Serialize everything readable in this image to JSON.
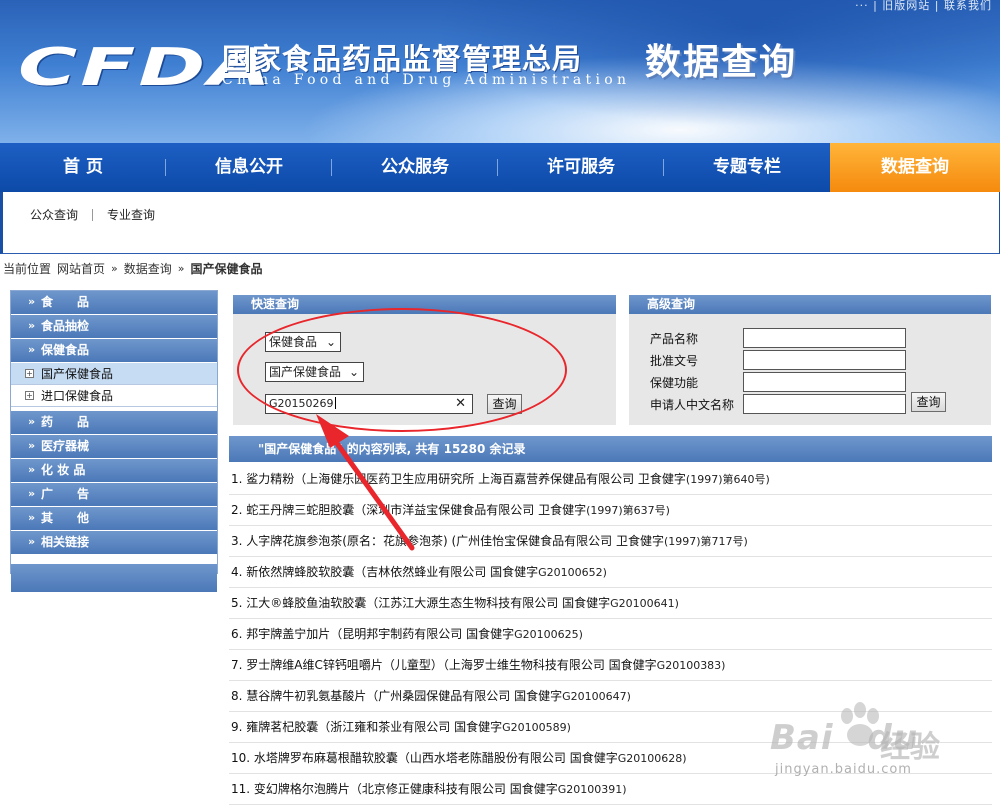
{
  "banner": {
    "top_links": "··· | 旧版网站 | 联系我们",
    "logo": "CFDA",
    "agency_cn": "国家食品药品监督管理总局",
    "agency_en": "China Food and Drug Administration",
    "subtitle": "数据查询"
  },
  "nav": {
    "items": [
      {
        "label": "首  页"
      },
      {
        "label": "信息公开"
      },
      {
        "label": "公众服务"
      },
      {
        "label": "许可服务"
      },
      {
        "label": "专题专栏"
      },
      {
        "label": "数据查询",
        "active": true
      }
    ],
    "active_color": "#f5900f"
  },
  "subnav": {
    "items": [
      "公众查询",
      "专业查询"
    ]
  },
  "breadcrumb": {
    "prefix": "当前位置",
    "home": "网站首页",
    "section": "数据查询",
    "current": "国产保健食品",
    "sep": "»"
  },
  "sidebar": {
    "items": [
      {
        "label": "食　　品"
      },
      {
        "label": "食品抽检"
      },
      {
        "label": "保健食品"
      }
    ],
    "sub_items": [
      {
        "label": "国产保健食品",
        "selected": true
      },
      {
        "label": "进口保健食品",
        "selected": false
      }
    ],
    "items_after": [
      {
        "label": "药　　品"
      },
      {
        "label": "医疗器械"
      },
      {
        "label": "化 妆 品"
      },
      {
        "label": "广　　告"
      },
      {
        "label": "其　　他"
      },
      {
        "label": "相关链接"
      }
    ],
    "chevron": "»",
    "box": "+"
  },
  "quick_search": {
    "title": "快速查询",
    "category_select": "保健食品",
    "type_select": "国产保健食品",
    "search_value": "G20150269",
    "clear_glyph": "✕",
    "submit": "查询",
    "chevron": "⌄"
  },
  "advanced_search": {
    "title": "高级查询",
    "fields": [
      "产品名称",
      "批准文号",
      "保健功能",
      "申请人中文名称"
    ],
    "submit": "查询"
  },
  "results": {
    "header": "\"国产保健食品\" 的内容列表, 共有 15280 余记录",
    "items": [
      {
        "text": "1. 鲨力精粉（上海健乐园医药卫生应用研究所 上海百嘉营养保健品有限公司 卫食健字",
        "approval": "(1997)第640号)"
      },
      {
        "text": "2. 蛇王丹牌三蛇胆胶囊（深圳市洋益宝保健食品有限公司 卫食健字",
        "approval": "(1997)第637号)"
      },
      {
        "text": "3. 人字牌花旗参泡茶(原名：花旗参泡茶) (广州佳怡宝保健食品有限公司 卫食健字",
        "approval": "(1997)第717号)"
      },
      {
        "text": "4. 新依然牌蜂胶软胶囊（吉林依然蜂业有限公司 国食健字",
        "approval": "G20100652)"
      },
      {
        "text": "5. 江大®蜂胶鱼油软胶囊（江苏江大源生态生物科技有限公司 国食健字",
        "approval": "G20100641)"
      },
      {
        "text": "6. 邦宇牌盖宁加片（昆明邦宇制药有限公司 国食健字",
        "approval": "G20100625)"
      },
      {
        "text": "7. 罗士牌维A维C锌钙咀嚼片（儿童型）（上海罗士维生物科技有限公司 国食健字",
        "approval": "G20100383)"
      },
      {
        "text": "8. 慧谷牌牛初乳氨基酸片（广州桑园保健品有限公司 国食健字",
        "approval": "G20100647)"
      },
      {
        "text": "9. 雍牌茗杞胶囊（浙江雍和茶业有限公司 国食健字",
        "approval": "G20100589)"
      },
      {
        "text": "10. 水塔牌罗布麻葛根醋软胶囊（山西水塔老陈醋股份有限公司 国食健字",
        "approval": "G20100628)"
      },
      {
        "text": "11. 变幻牌格尔泡腾片（北京修正健康科技有限公司 国食健字",
        "approval": "G20100391)"
      }
    ]
  },
  "watermark": {
    "brand": "Bai",
    "brand2": "du",
    "cn": "经验",
    "url": "jingyan.baidu.com"
  },
  "colors": {
    "nav_blue": "#0d4aa8",
    "panel_blue": "#4b78b8",
    "annotation_red": "#e8262b"
  }
}
